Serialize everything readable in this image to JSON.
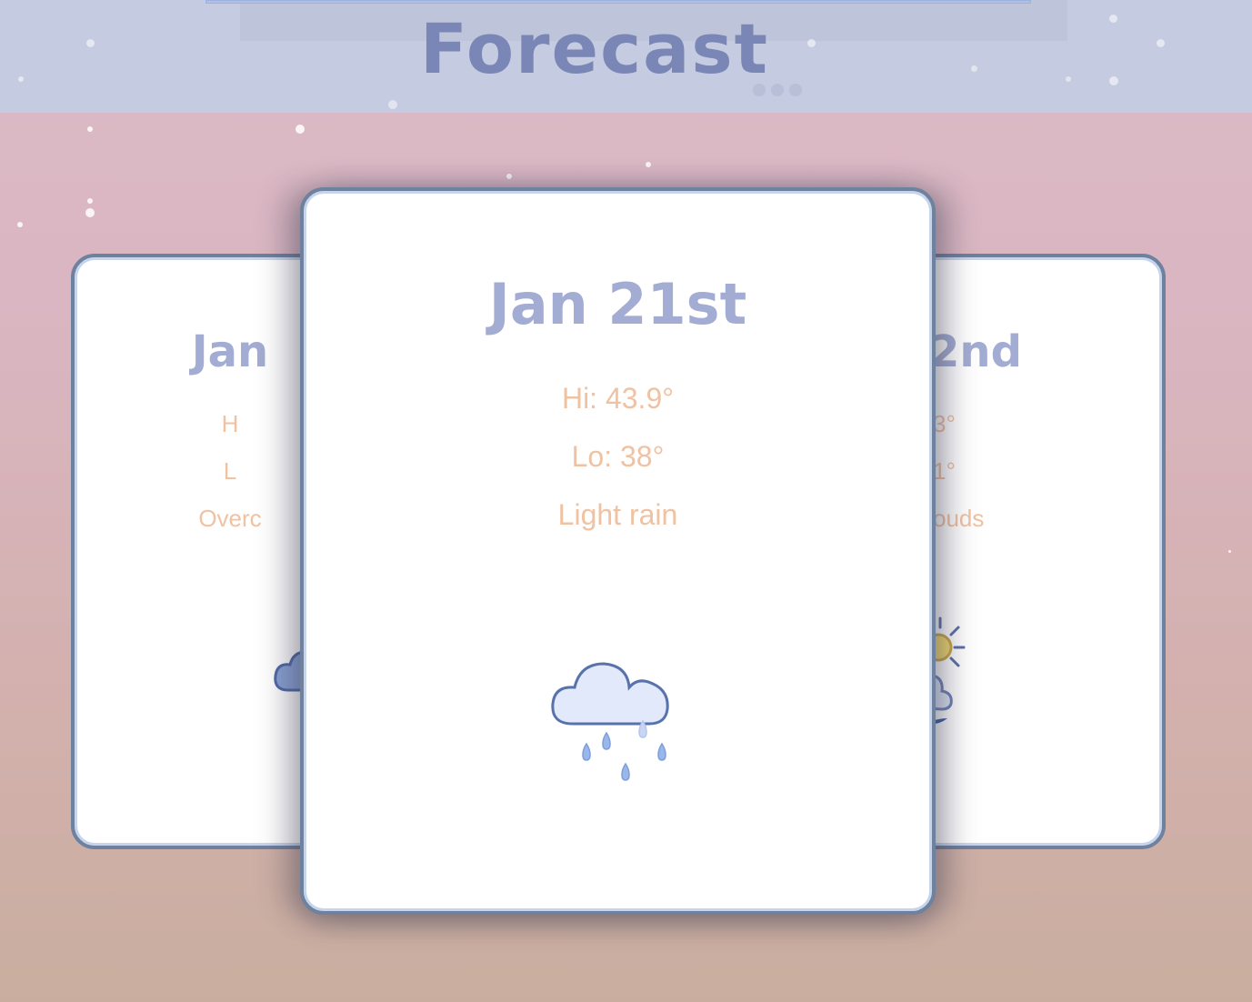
{
  "header": {
    "title": "Forecast",
    "loading_indicator": "..."
  },
  "colors": {
    "header_band": "#c5cbe0",
    "title": "#7a86b5",
    "date_text": "#a3acd2",
    "info_text": "#f0c2a2",
    "card_border": "#6e819e",
    "background_top": "#dbbac7",
    "background_bottom": "#c9ae9f"
  },
  "forecast": {
    "previous": {
      "date": "Jan",
      "hi": "H",
      "lo": "L",
      "description": "Overc",
      "icon": "overcast-cloud-icon"
    },
    "current": {
      "date": "Jan 21st",
      "hi": "Hi: 43.9°",
      "lo": "Lo: 38°",
      "description": "Light rain",
      "icon": "light-rain-icon"
    },
    "next": {
      "date": "2nd",
      "hi": "3°",
      "lo": "1°",
      "description": "ouds",
      "icon": "partly-cloudy-sun-icon"
    }
  }
}
